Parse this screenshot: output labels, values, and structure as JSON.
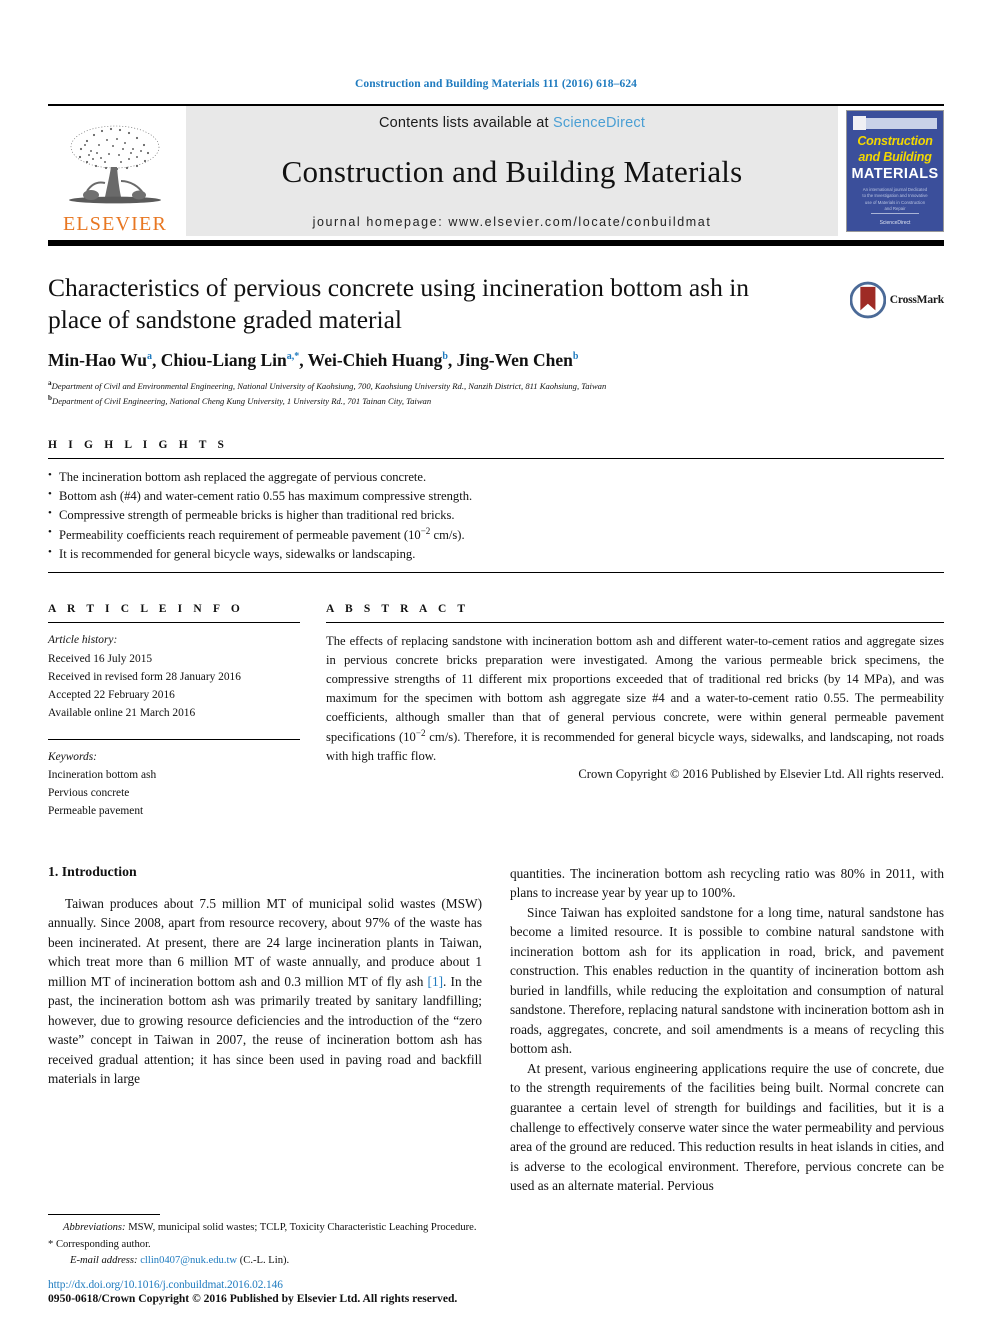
{
  "running_head": "Construction and Building Materials 111 (2016) 618–624",
  "masthead": {
    "contents_prefix": "Contents lists available at ",
    "sciencedirect": "ScienceDirect",
    "journal_title": "Construction and Building Materials",
    "homepage": "journal homepage: www.elsevier.com/locate/conbuildmat",
    "publisher_logo_text": "ELSEVIER",
    "accent_blue": "#4a9fd4",
    "elsevier_orange": "#E87722",
    "cover": {
      "line1": "Construction",
      "line2": "and Building",
      "line3": "MATERIALS",
      "blurb": "An international journal Dedicated to the Investigation and Innovative use of Materials in Construction and Repair",
      "footer": "ScienceDirect",
      "bg_color": "#3b4f9b",
      "title_color": "#f3d800"
    }
  },
  "article": {
    "title": "Characteristics of pervious concrete using incineration bottom ash in place of sandstone graded material",
    "authors_html": "Min-Hao Wu a, Chiou-Liang Lin a,*, Wei-Chieh Huang b, Jing-Wen Chen b",
    "authors": [
      {
        "name": "Min-Hao Wu",
        "sup": "a"
      },
      {
        "name": "Chiou-Liang Lin",
        "sup": "a,*"
      },
      {
        "name": "Wei-Chieh Huang",
        "sup": "b"
      },
      {
        "name": "Jing-Wen Chen",
        "sup": "b"
      }
    ],
    "affiliations": [
      {
        "mark": "a",
        "text": "Department of Civil and Environmental Engineering, National University of Kaohsiung, 700, Kaohsiung University Rd., Nanzih District, 811 Kaohsiung, Taiwan"
      },
      {
        "mark": "b",
        "text": "Department of Civil Engineering, National Cheng Kung University, 1 University Rd., 701 Tainan City, Taiwan"
      }
    ],
    "crossmark_label": "CrossMark"
  },
  "highlights": {
    "heading": "H I G H L I G H T S",
    "items": [
      "The incineration bottom ash replaced the aggregate of pervious concrete.",
      "Bottom ash (#4) and water-cement ratio 0.55 has maximum compressive strength.",
      "Compressive strength of permeable bricks is higher than traditional red bricks.",
      "Permeability coefficients reach requirement of permeable pavement (10−2 cm/s).",
      "It is recommended for general bicycle ways, sidewalks or landscaping."
    ]
  },
  "article_info": {
    "heading": "A R T I C L E    I N F O",
    "history_label": "Article history:",
    "history": [
      "Received 16 July 2015",
      "Received in revised form 28 January 2016",
      "Accepted 22 February 2016",
      "Available online 21 March 2016"
    ],
    "keywords_label": "Keywords:",
    "keywords": [
      "Incineration bottom ash",
      "Pervious concrete",
      "Permeable pavement"
    ]
  },
  "abstract": {
    "heading": "A B S T R A C T",
    "text_part1": "The effects of replacing sandstone with incineration bottom ash and different water-to-cement ratios and aggregate sizes in pervious concrete bricks preparation were investigated. Among the various permeable brick specimens, the compressive strengths of 11 different mix proportions exceeded that of traditional red bricks (by 14 MPa), and was maximum for the specimen with bottom ash aggregate size #4 and a water-to-cement ratio 0.55. The permeability coefficients, although smaller than that of general pervious concrete, were within general permeable pavement specifications (10",
    "text_sup": "−2",
    "text_part2": " cm/s). Therefore, it is recommended for general bicycle ways, sidewalks, and landscaping, not roads with high traffic flow.",
    "copyright": "Crown Copyright © 2016 Published by Elsevier Ltd. All rights reserved."
  },
  "body": {
    "section_title": "1. Introduction",
    "left_para_1_a": "Taiwan produces about 7.5 million MT of municipal solid wastes (MSW) annually. Since 2008, apart from resource recovery, about 97% of the waste has been incinerated. At present, there are 24 large incineration plants in Taiwan, which treat more than 6 million MT of waste annually, and produce about 1 million MT of incineration bottom ash and 0.3 million MT of fly ash ",
    "left_para_1_ref": "[1]",
    "left_para_1_b": ". In the past, the incineration bottom ash was primarily treated by sanitary landfilling; however, due to growing resource deficiencies and the introduction of the “zero waste” concept in Taiwan in 2007, the reuse of incineration bottom ash has received gradual attention; it has since been used in paving road and backfill materials in large",
    "right_para_1": "quantities. The incineration bottom ash recycling ratio was 80% in 2011, with plans to increase year by year up to 100%.",
    "right_para_2": "Since Taiwan has exploited sandstone for a long time, natural sandstone has become a limited resource. It is possible to combine natural sandstone with incineration bottom ash for its application in road, brick, and pavement construction. This enables reduction in the quantity of incineration bottom ash buried in landfills, while reducing the exploitation and consumption of natural sandstone. Therefore, replacing natural sandstone with incineration bottom ash in roads, aggregates, concrete, and soil amendments is a means of recycling this bottom ash.",
    "right_para_3": "At present, various engineering applications require the use of concrete, due to the strength requirements of the facilities being built. Normal concrete can guarantee a certain level of strength for buildings and facilities, but it is a challenge to effectively conserve water since the water permeability and pervious area of the ground are reduced. This reduction results in heat islands in cities, and is adverse to the ecological environment. Therefore, pervious concrete can be used as an alternate material. Pervious"
  },
  "footnotes": {
    "abbrev_label": "Abbreviations:",
    "abbrev_text": " MSW, municipal solid wastes; TCLP, Toxicity Characteristic Leaching Procedure.",
    "corresponding": "* Corresponding author.",
    "email_label": "E-mail address:",
    "email": "cllin0407@nuk.edu.tw",
    "email_suffix": " (C.-L. Lin).",
    "doi": "http://dx.doi.org/10.1016/j.conbuildmat.2016.02.146",
    "issn_line": "0950-0618/Crown Copyright © 2016 Published by Elsevier Ltd. All rights reserved."
  }
}
